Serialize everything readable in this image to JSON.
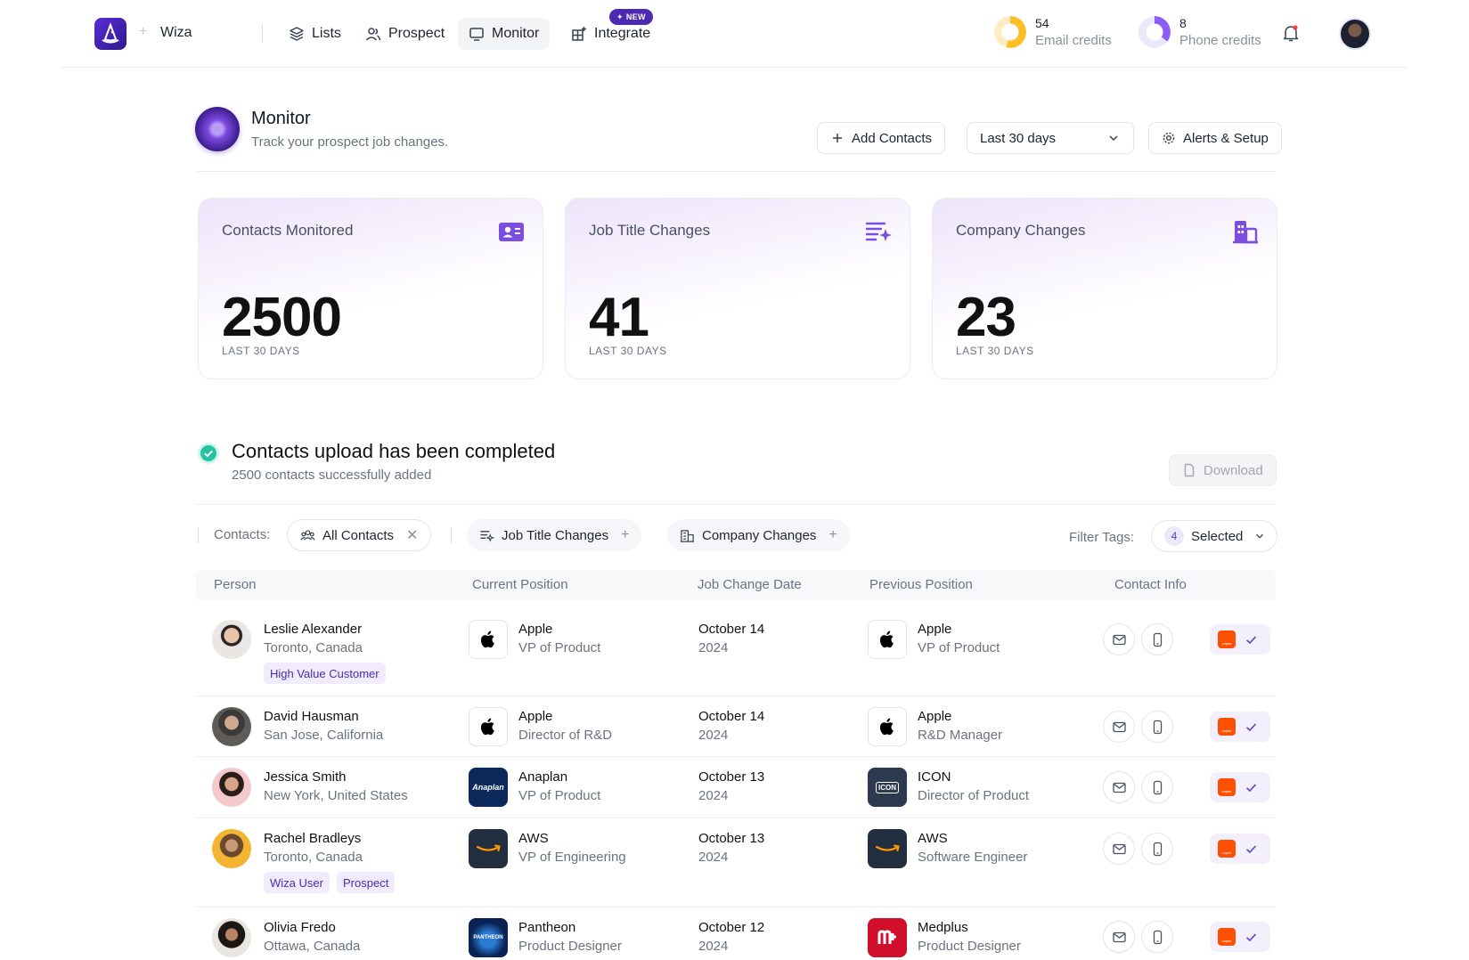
{
  "nav": {
    "workspace": "Wiza",
    "items": [
      {
        "label": "Lists"
      },
      {
        "label": "Prospect"
      },
      {
        "label": "Monitor"
      },
      {
        "label": "Integrate"
      }
    ],
    "new_badge": "NEW"
  },
  "credits": {
    "email": {
      "value": "54",
      "label": "Email credits",
      "fill": 0.54
    },
    "phone": {
      "value": "8",
      "label": "Phone credits",
      "fill": 0.35
    }
  },
  "header": {
    "title": "Monitor",
    "subtitle": "Track your prospect job changes.",
    "add_contacts": "Add Contacts",
    "period": "Last 30 days",
    "alerts": "Alerts & Setup"
  },
  "stats": [
    {
      "title": "Contacts Monitored",
      "value": "2500",
      "label": "LAST 30 DAYS",
      "icon": "contact-card-icon"
    },
    {
      "title": "Job Title Changes",
      "value": "41",
      "label": "LAST 30 DAYS",
      "icon": "list-sparkle-icon"
    },
    {
      "title": "Company Changes",
      "value": "23",
      "label": "LAST 30 DAYS",
      "icon": "building-icon"
    }
  ],
  "upload": {
    "title": "Contacts upload has been completed",
    "subtitle": "2500 contacts successfully added",
    "download": "Download"
  },
  "filters": {
    "contacts_label": "Contacts:",
    "all_contacts": "All Contacts",
    "job_title_changes": "Job Title Changes",
    "company_changes": "Company Changes",
    "filter_tags_label": "Filter Tags:",
    "selected_count": "4",
    "selected_label": "Selected"
  },
  "table": {
    "columns": [
      "Person",
      "Current Position",
      "Job Change Date",
      "Previous Position",
      "Contact Info"
    ],
    "rows": [
      {
        "name": "Leslie Alexander",
        "location": "Toronto, Canada",
        "tags": [
          "High Value Customer"
        ],
        "current_company": "Apple",
        "current_role": "VP of Product",
        "date": "October 14",
        "year": "2024",
        "prev_company": "Apple",
        "prev_role": "VP of Product"
      },
      {
        "name": "David Hausman",
        "location": "San Jose, California",
        "tags": [],
        "current_company": "Apple",
        "current_role": "Director of R&D",
        "date": "October 14",
        "year": "2024",
        "prev_company": "Apple",
        "prev_role": "R&D Manager"
      },
      {
        "name": "Jessica Smith",
        "location": "New York, United States",
        "tags": [],
        "current_company": "Anaplan",
        "current_role": "VP of Product",
        "date": "October 13",
        "year": "2024",
        "prev_company": "ICON",
        "prev_role": "Director of Product"
      },
      {
        "name": "Rachel Bradleys",
        "location": "Toronto, Canada",
        "tags": [
          "Wiza User",
          "Prospect"
        ],
        "current_company": "AWS",
        "current_role": "VP of Engineering",
        "date": "October 13",
        "year": "2024",
        "prev_company": "AWS",
        "prev_role": "Software Engineer"
      },
      {
        "name": "Olivia Fredo",
        "location": "Ottawa, Canada",
        "tags": [],
        "current_company": "Pantheon",
        "current_role": "Product Designer",
        "date": "October 12",
        "year": "2024",
        "prev_company": "Medplus",
        "prev_role": "Product Designer"
      }
    ],
    "logo_text": {
      "anaplan": "Anaplan",
      "icon": "ICON",
      "pantheon": "PANTHEON",
      "zapier": "zapier"
    }
  },
  "colors": {
    "accent": "#5b2bd6",
    "success": "#22c3a0",
    "zapier": "#ff4f00"
  }
}
